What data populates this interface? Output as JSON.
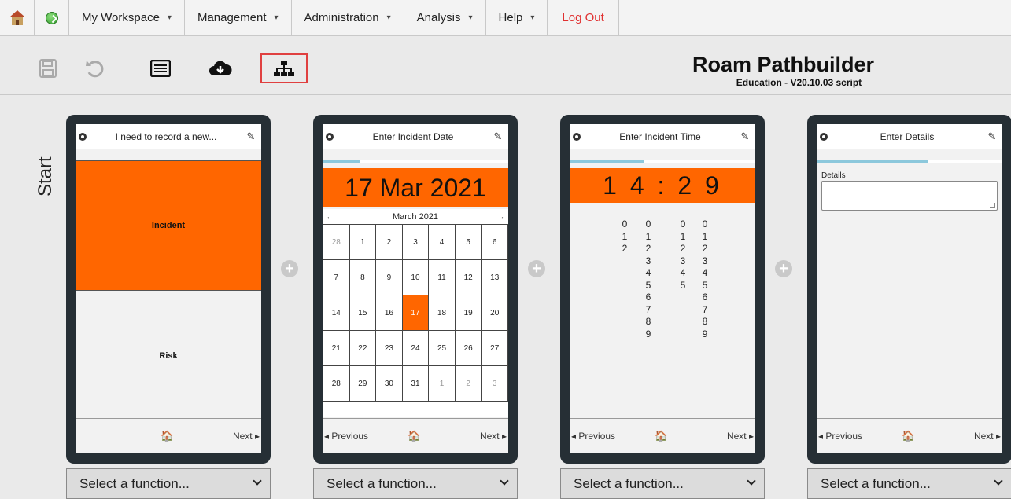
{
  "menu": {
    "items": [
      {
        "label": "My Workspace",
        "caret": "▾"
      },
      {
        "label": "Management",
        "caret": "▾"
      },
      {
        "label": "Administration",
        "caret": "▾"
      },
      {
        "label": "Analysis",
        "caret": "▾"
      },
      {
        "label": "Help",
        "caret": "▾"
      }
    ],
    "logout": "Log Out",
    "logout_color": "#e03030"
  },
  "header": {
    "title": "Roam Pathbuilder",
    "subtitle": "Education - V20.10.03 script"
  },
  "toolbar": {
    "icons": [
      "save-icon",
      "undo-icon",
      "list-icon",
      "cloud-download-icon",
      "sitemap-icon"
    ],
    "active_icon": "sitemap-icon"
  },
  "workspace": {
    "start_label": "Start",
    "add_symbol": "+",
    "accent_color": "#ff6600",
    "progress_color": "#8cc8dc"
  },
  "cards": [
    {
      "title": "I need to record a new...",
      "options": [
        "Incident",
        "Risk"
      ],
      "selected_option": "Incident",
      "footer": {
        "home": "🏠",
        "next": "Next ▸"
      },
      "select": "Select a function..."
    },
    {
      "title": "Enter Incident Date",
      "progress": 0.2,
      "date_display": "17 Mar 2021",
      "calendar": {
        "month": "March 2021",
        "prev_arrow": "←",
        "next_arrow": "→",
        "days": [
          {
            "d": "28",
            "other": true
          },
          {
            "d": "1"
          },
          {
            "d": "2"
          },
          {
            "d": "3"
          },
          {
            "d": "4"
          },
          {
            "d": "5"
          },
          {
            "d": "6"
          },
          {
            "d": "7"
          },
          {
            "d": "8"
          },
          {
            "d": "9"
          },
          {
            "d": "10"
          },
          {
            "d": "11"
          },
          {
            "d": "12"
          },
          {
            "d": "13"
          },
          {
            "d": "14"
          },
          {
            "d": "15"
          },
          {
            "d": "16"
          },
          {
            "d": "17",
            "selected": true
          },
          {
            "d": "18"
          },
          {
            "d": "19"
          },
          {
            "d": "20"
          },
          {
            "d": "21"
          },
          {
            "d": "22"
          },
          {
            "d": "23"
          },
          {
            "d": "24"
          },
          {
            "d": "25"
          },
          {
            "d": "26"
          },
          {
            "d": "27"
          },
          {
            "d": "28"
          },
          {
            "d": "29"
          },
          {
            "d": "30"
          },
          {
            "d": "31"
          },
          {
            "d": "1",
            "other": true
          },
          {
            "d": "2",
            "other": true
          },
          {
            "d": "3",
            "other": true
          }
        ]
      },
      "footer": {
        "previous": "◂ Previous",
        "home": "🏠",
        "next": "Next ▸"
      },
      "select": "Select a function..."
    },
    {
      "title": "Enter Incident Time",
      "progress": 0.4,
      "time_display": "14:29",
      "digit_columns": [
        [
          "0",
          "1",
          "2"
        ],
        [
          "0",
          "1",
          "2",
          "3",
          "4",
          "5",
          "6",
          "7",
          "8",
          "9"
        ],
        [
          "0",
          "1",
          "2",
          "3",
          "4",
          "5"
        ],
        [
          "0",
          "1",
          "2",
          "3",
          "4",
          "5",
          "6",
          "7",
          "8",
          "9"
        ]
      ],
      "footer": {
        "previous": "◂ Previous",
        "home": "🏠",
        "next": "Next ▸"
      },
      "select": "Select a function..."
    },
    {
      "title": "Enter Details",
      "progress": 0.6,
      "field_label": "Details",
      "field_value": "",
      "footer": {
        "previous": "◂ Previous",
        "home": "🏠",
        "next": "Next ▸"
      },
      "select": "Select a function..."
    }
  ]
}
